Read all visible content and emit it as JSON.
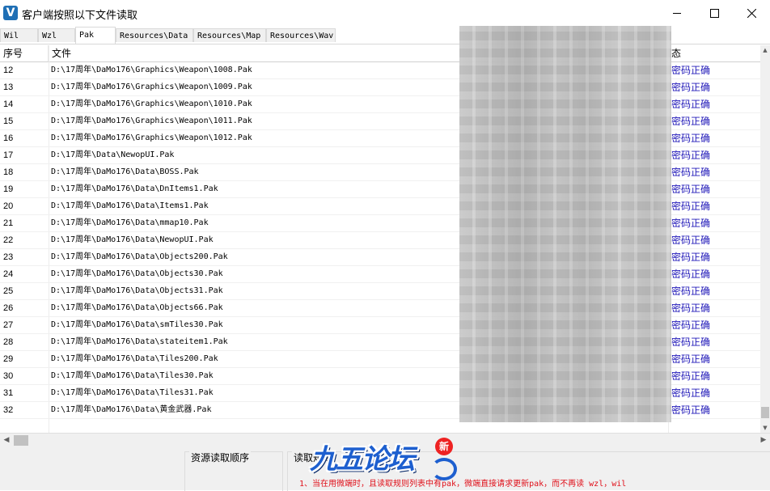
{
  "window": {
    "title": "客户端按照以下文件读取",
    "icon_glyph": "V"
  },
  "tabs": [
    {
      "label": "Wil"
    },
    {
      "label": "Wzl"
    },
    {
      "label": "Pak",
      "active": true
    },
    {
      "label": "Resources\\Data"
    },
    {
      "label": "Resources\\Map"
    },
    {
      "label": "Resources\\Wav"
    }
  ],
  "table": {
    "headers": {
      "num": "序号",
      "file": "文件",
      "status": "态"
    },
    "rows": [
      {
        "num": "12",
        "file": "D:\\17周年\\DaMo176\\Graphics\\Weapon\\1008.Pak",
        "status": "密码正确"
      },
      {
        "num": "13",
        "file": "D:\\17周年\\DaMo176\\Graphics\\Weapon\\1009.Pak",
        "status": "密码正确"
      },
      {
        "num": "14",
        "file": "D:\\17周年\\DaMo176\\Graphics\\Weapon\\1010.Pak",
        "status": "密码正确"
      },
      {
        "num": "15",
        "file": "D:\\17周年\\DaMo176\\Graphics\\Weapon\\1011.Pak",
        "status": "密码正确"
      },
      {
        "num": "16",
        "file": "D:\\17周年\\DaMo176\\Graphics\\Weapon\\1012.Pak",
        "status": "密码正确"
      },
      {
        "num": "17",
        "file": "D:\\17周年\\Data\\NewopUI.Pak",
        "status": "密码正确"
      },
      {
        "num": "18",
        "file": "D:\\17周年\\DaMo176\\Data\\BOSS.Pak",
        "status": "密码正确"
      },
      {
        "num": "19",
        "file": "D:\\17周年\\DaMo176\\Data\\DnItems1.Pak",
        "status": "密码正确"
      },
      {
        "num": "20",
        "file": "D:\\17周年\\DaMo176\\Data\\Items1.Pak",
        "status": "密码正确"
      },
      {
        "num": "21",
        "file": "D:\\17周年\\DaMo176\\Data\\mmap10.Pak",
        "status": "密码正确"
      },
      {
        "num": "22",
        "file": "D:\\17周年\\DaMo176\\Data\\NewopUI.Pak",
        "status": "密码正确"
      },
      {
        "num": "23",
        "file": "D:\\17周年\\DaMo176\\Data\\Objects200.Pak",
        "status": "密码正确"
      },
      {
        "num": "24",
        "file": "D:\\17周年\\DaMo176\\Data\\Objects30.Pak",
        "status": "密码正确"
      },
      {
        "num": "25",
        "file": "D:\\17周年\\DaMo176\\Data\\Objects31.Pak",
        "status": "密码正确"
      },
      {
        "num": "26",
        "file": "D:\\17周年\\DaMo176\\Data\\Objects66.Pak",
        "status": "密码正确"
      },
      {
        "num": "27",
        "file": "D:\\17周年\\DaMo176\\Data\\smTiles30.Pak",
        "status": "密码正确"
      },
      {
        "num": "28",
        "file": "D:\\17周年\\DaMo176\\Data\\stateitem1.Pak",
        "status": "密码正确"
      },
      {
        "num": "29",
        "file": "D:\\17周年\\DaMo176\\Data\\Tiles200.Pak",
        "status": "密码正确"
      },
      {
        "num": "30",
        "file": "D:\\17周年\\DaMo176\\Data\\Tiles30.Pak",
        "status": "密码正确"
      },
      {
        "num": "31",
        "file": "D:\\17周年\\DaMo176\\Data\\Tiles31.Pak",
        "status": "密码正确"
      },
      {
        "num": "32",
        "file": "D:\\17周年\\DaMo176\\Data\\黄金武器.Pak",
        "status": "密码正确"
      }
    ]
  },
  "bottom": {
    "order_group_title": "资源读取顺序",
    "rule_group_title": "读取规则",
    "note": "1、当在用微端时，且读取规则列表中有pak，微端直接请求更新pak，而不再读 wzl，wil"
  },
  "watermark": {
    "text": "九五论坛",
    "badge": "新"
  },
  "colors": {
    "status_text": "#2018b8",
    "note_text": "#e0101a",
    "icon_bg": "#1f6fb5"
  }
}
